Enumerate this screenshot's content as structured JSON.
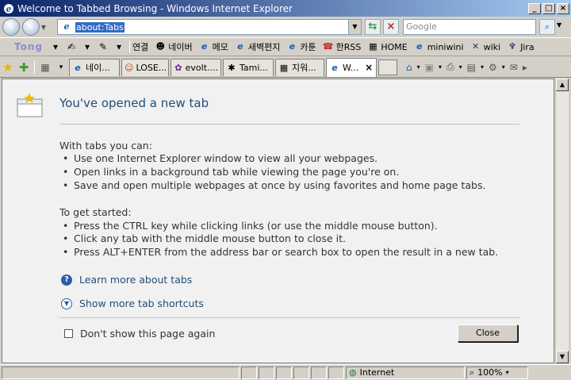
{
  "window": {
    "title": "Welcome to Tabbed Browsing - Windows Internet Explorer",
    "btn_min": "_",
    "btn_max": "□",
    "btn_close": "×"
  },
  "address": {
    "value": "about:Tabs"
  },
  "search": {
    "placeholder": "Google"
  },
  "links": {
    "logo": "Tong",
    "items": [
      {
        "label": "연결",
        "icon": "link-icon"
      },
      {
        "label": "네이버",
        "icon": "naver-icon"
      },
      {
        "label": "메모",
        "icon": "ie-page-icon"
      },
      {
        "label": "새벽편지",
        "icon": "ie-page-icon"
      },
      {
        "label": "카툰",
        "icon": "ie-page-icon"
      },
      {
        "label": "한RSS",
        "icon": "rss-icon"
      },
      {
        "label": "HOME",
        "icon": "home-page-icon"
      },
      {
        "label": "miniwini",
        "icon": "ie-page-icon"
      },
      {
        "label": "wiki",
        "icon": "wiki-icon"
      },
      {
        "label": "Jira",
        "icon": "jira-icon"
      }
    ]
  },
  "tabs": [
    {
      "label": "네이..."
    },
    {
      "label": "LOSE..."
    },
    {
      "label": "evolt...."
    },
    {
      "label": "Tami..."
    },
    {
      "label": "지워..."
    },
    {
      "label": "W...",
      "active": true,
      "close": "×"
    }
  ],
  "content": {
    "heading": "You've opened a new tab",
    "with_tabs": {
      "title": "With tabs you can:",
      "bullets": [
        "Use one Internet Explorer window to view all your webpages.",
        "Open links in a background tab while viewing the page you're on.",
        "Save and open multiple webpages at once by using favorites and home page tabs."
      ]
    },
    "get_started": {
      "title": "To get started:",
      "bullets": [
        "Press the CTRL key while clicking links (or use the middle mouse button).",
        "Click any tab with the middle mouse button to close it.",
        "Press ALT+ENTER from the address bar or search box to open the result in a new tab."
      ]
    },
    "learn_more": "Learn more about tabs",
    "show_shortcuts": "Show more tab shortcuts",
    "dont_show": "Don't show this page again",
    "close_button": "Close"
  },
  "status": {
    "zone": "Internet",
    "zoom": "100%"
  }
}
